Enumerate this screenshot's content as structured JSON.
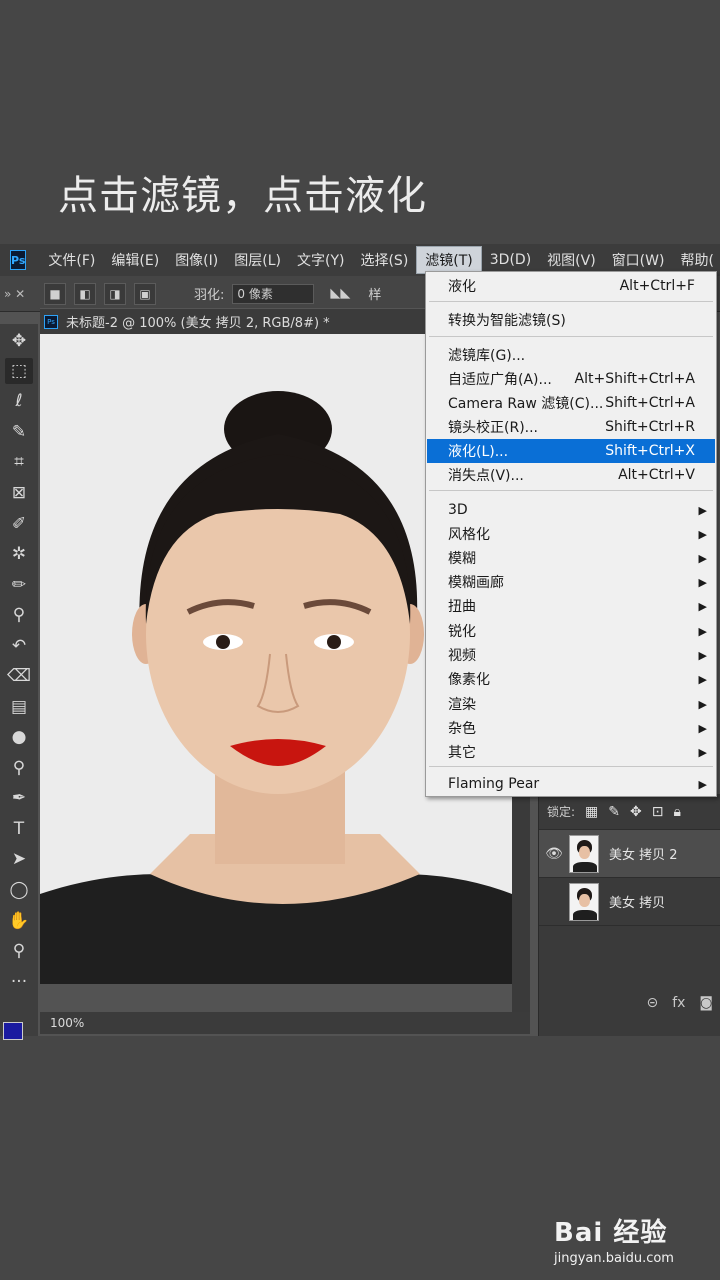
{
  "caption": "点击滤镜，点击液化",
  "app": {
    "logo": "Ps",
    "menubar": [
      {
        "label": "文件(F)"
      },
      {
        "label": "编辑(E)"
      },
      {
        "label": "图像(I)"
      },
      {
        "label": "图层(L)"
      },
      {
        "label": "文字(Y)"
      },
      {
        "label": "选择(S)"
      },
      {
        "label": "滤镜(T)",
        "active": true
      },
      {
        "label": "3D(D)"
      },
      {
        "label": "视图(V)"
      },
      {
        "label": "窗口(W)"
      },
      {
        "label": "帮助("
      }
    ],
    "options": {
      "feather_label": "羽化:",
      "feather_value": "0 像素",
      "style_label": "样"
    },
    "document": {
      "tab_title": "未标题-2 @ 100% (美女 拷贝 2, RGB/8#) *",
      "zoom": "100%"
    },
    "layers_panel": {
      "lock_label": "锁定:",
      "layers": [
        {
          "name": "美女 拷贝 2",
          "visible": true,
          "active": true
        },
        {
          "name": "美女 拷贝",
          "visible": false,
          "active": false
        }
      ],
      "fx_label": "fx"
    },
    "filter_menu": {
      "items": [
        {
          "label": "液化",
          "shortcut": "Alt+Ctrl+F"
        },
        {
          "label": "转换为智能滤镜(S)",
          "shortcut": ""
        },
        {
          "label": "滤镜库(G)...",
          "shortcut": ""
        },
        {
          "label": "自适应广角(A)...",
          "shortcut": "Alt+Shift+Ctrl+A"
        },
        {
          "label": "Camera Raw 滤镜(C)...",
          "shortcut": "Shift+Ctrl+A"
        },
        {
          "label": "镜头校正(R)...",
          "shortcut": "Shift+Ctrl+R"
        },
        {
          "label": "液化(L)...",
          "shortcut": "Shift+Ctrl+X",
          "highlighted": true
        },
        {
          "label": "消失点(V)...",
          "shortcut": "Alt+Ctrl+V"
        },
        {
          "label": "3D",
          "submenu": true
        },
        {
          "label": "风格化",
          "submenu": true
        },
        {
          "label": "模糊",
          "submenu": true
        },
        {
          "label": "模糊画廊",
          "submenu": true
        },
        {
          "label": "扭曲",
          "submenu": true
        },
        {
          "label": "锐化",
          "submenu": true
        },
        {
          "label": "视频",
          "submenu": true
        },
        {
          "label": "像素化",
          "submenu": true
        },
        {
          "label": "渲染",
          "submenu": true
        },
        {
          "label": "杂色",
          "submenu": true
        },
        {
          "label": "其它",
          "submenu": true
        },
        {
          "label": "Flaming Pear",
          "submenu": true
        }
      ],
      "submenu_arrow": "▶"
    }
  },
  "watermark": {
    "brand": "Bai 经验",
    "url": "jingyan.baidu.com"
  },
  "colors": {
    "menu_highlight": "#0a6fd6",
    "foreground_swatch": "#1b1ba0",
    "lipstick": "#c8150f"
  }
}
